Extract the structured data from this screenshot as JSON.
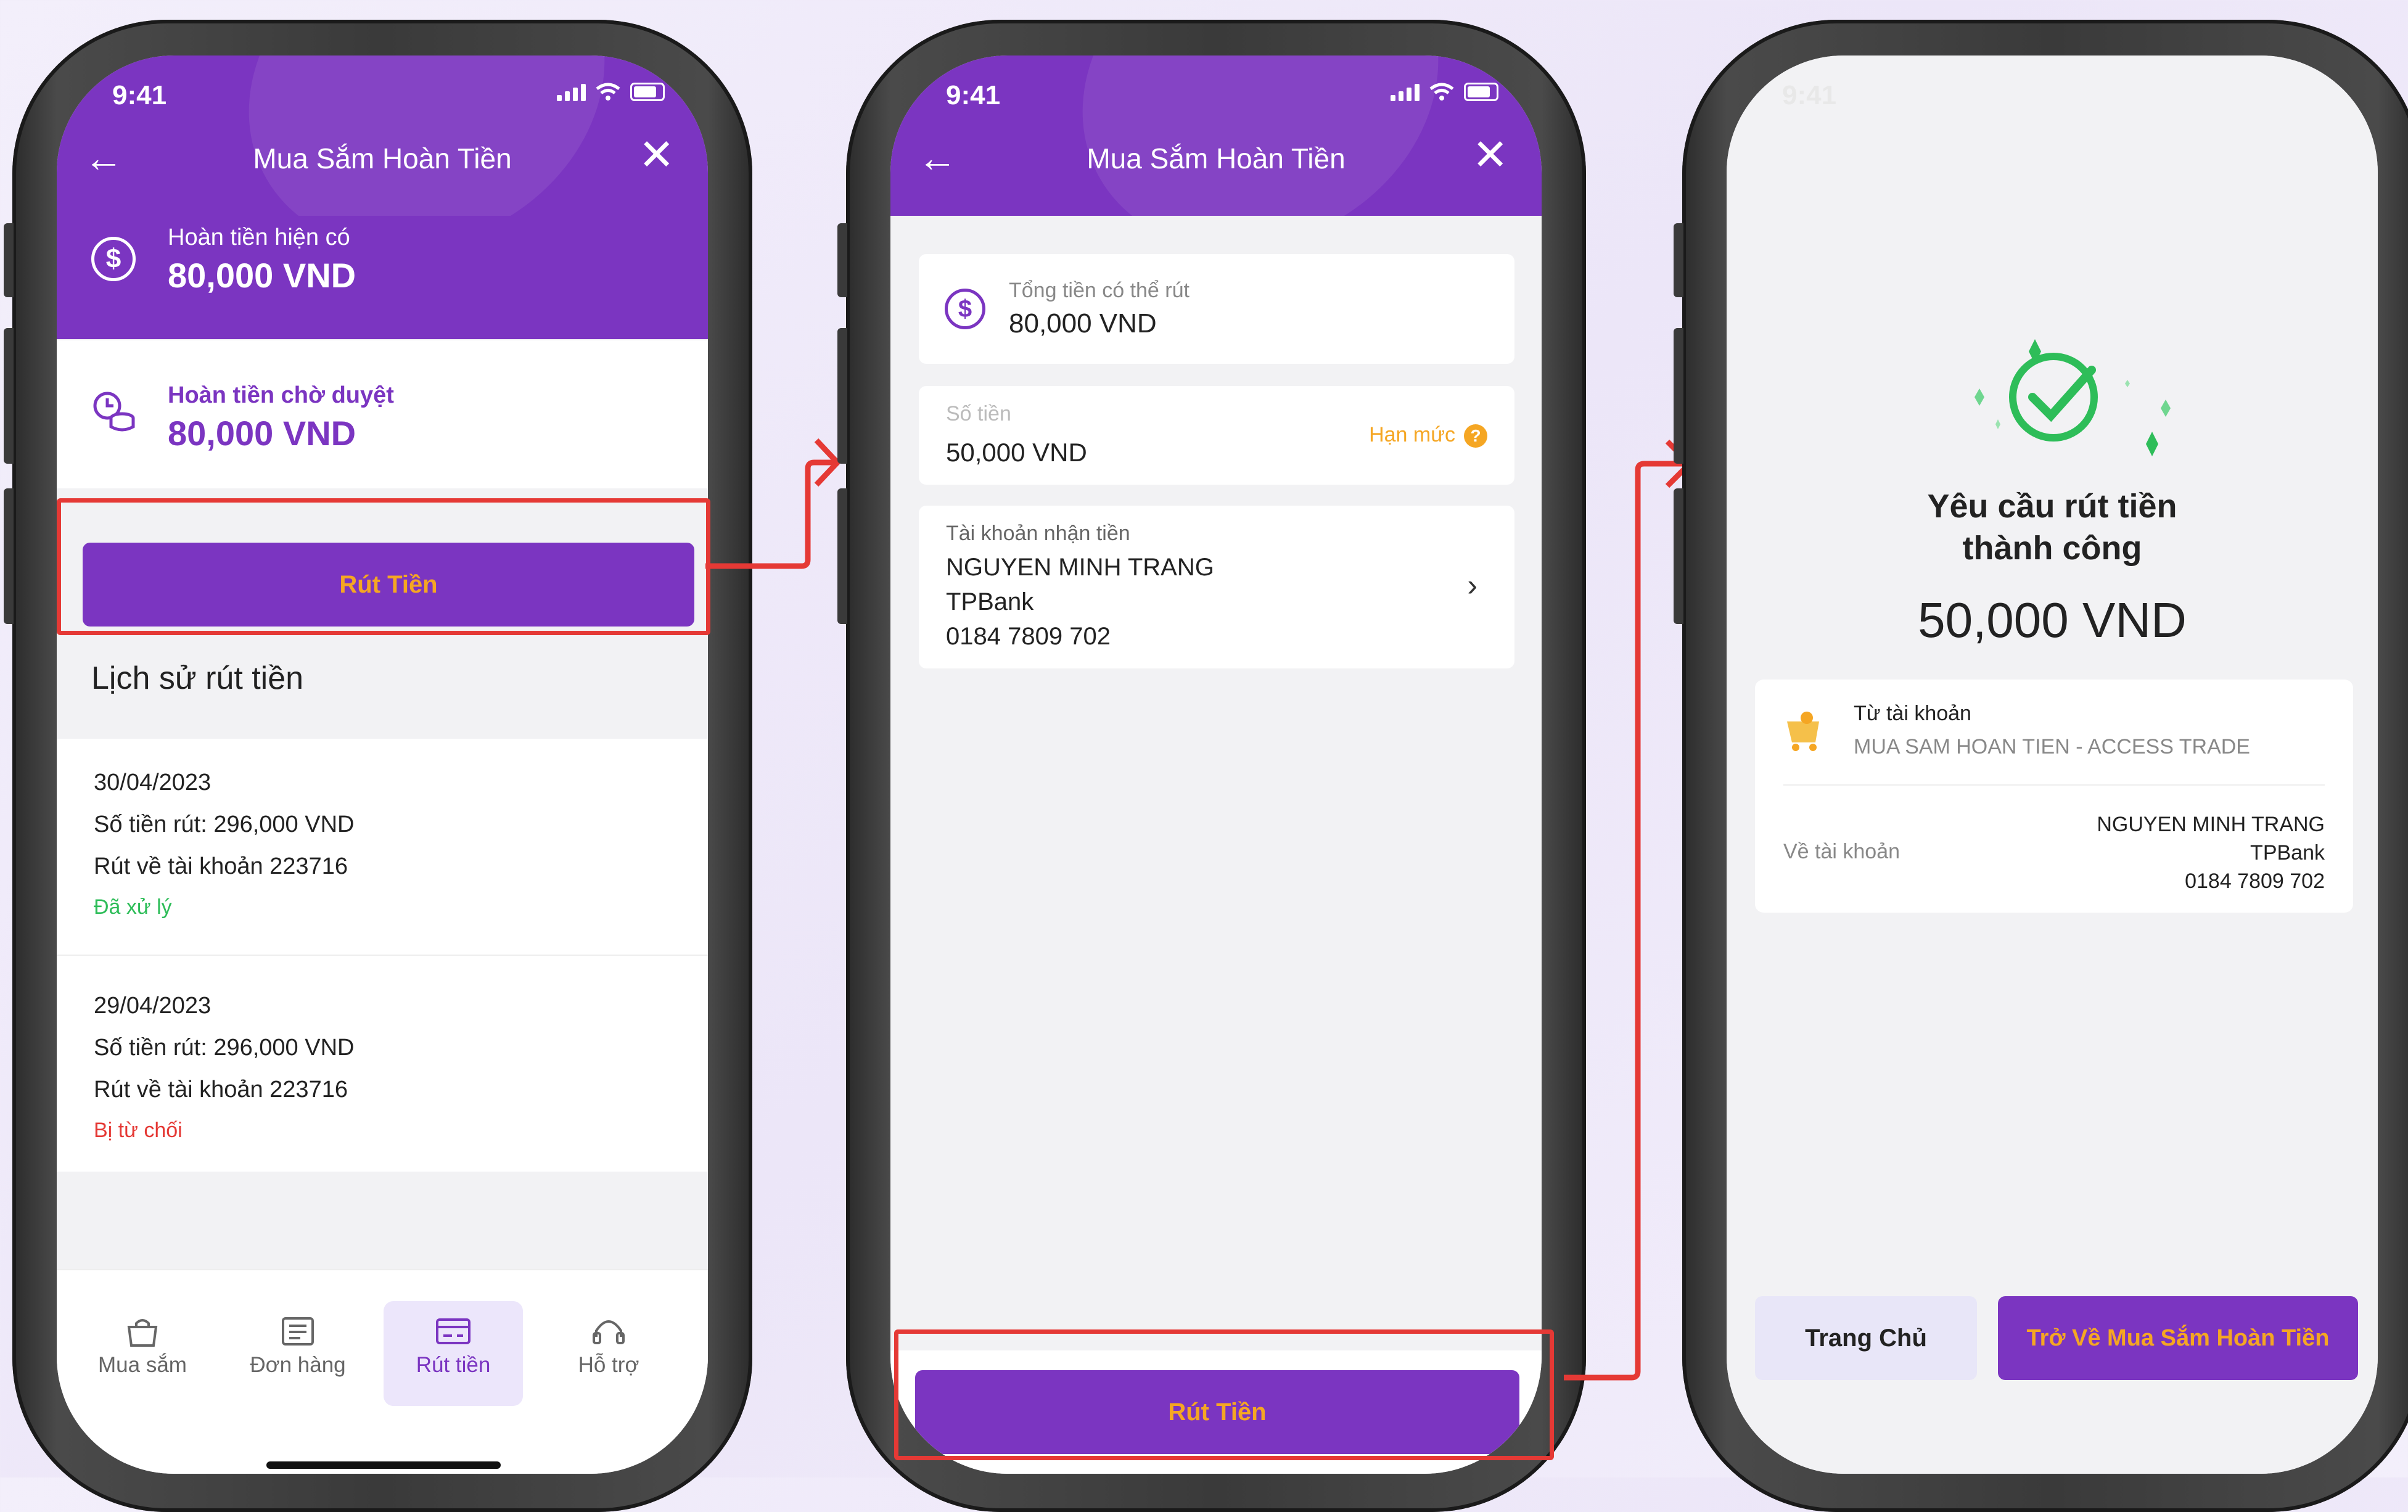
{
  "status": {
    "time": "9:41"
  },
  "screen1": {
    "header_title": "Mua Sắm Hoàn Tiền",
    "available_label": "Hoàn tiền hiện có",
    "available_value": "80,000 VND",
    "pending_label": "Hoàn tiền chờ duyệt",
    "pending_value": "80,000 VND",
    "withdraw_button": "Rút Tiền",
    "history_title": "Lịch sử rút tiền",
    "history": [
      {
        "date": "30/04/2023",
        "amount": "Số tiền rút: 296,000 VND",
        "account": "Rút về tài khoản 223716",
        "status": "Đã xử lý"
      },
      {
        "date": "29/04/2023",
        "amount": "Số tiền rút: 296,000 VND",
        "account": "Rút về tài khoản 223716",
        "status": "Bị từ chối"
      }
    ],
    "tabs": [
      {
        "label": "Mua sắm",
        "icon": "shopping-bag-icon"
      },
      {
        "label": "Đơn hàng",
        "icon": "order-list-icon"
      },
      {
        "label": "Rút tiền",
        "icon": "card-withdraw-icon"
      },
      {
        "label": "Hỗ trợ",
        "icon": "headset-icon"
      }
    ]
  },
  "screen2": {
    "header_title": "Mua Sắm Hoàn Tiền",
    "total_label": "Tổng tiền có thể rút",
    "total_value": "80,000 VND",
    "amount_label": "Số tiền",
    "amount_value": "50,000 VND",
    "limit_label": "Hạn mức",
    "receive_label": "Tài khoản nhận tiền",
    "receive_name": "NGUYEN MINH TRANG",
    "receive_bank": "TPBank",
    "receive_number": "0184 7809 702",
    "withdraw_button": "Rút Tiền"
  },
  "screen3": {
    "title_line1": "Yêu cầu rút tiền",
    "title_line2": "thành công",
    "amount": "50,000 VND",
    "from_label": "Từ tài khoản",
    "from_value": "MUA SAM HOAN TIEN - ACCESS TRADE",
    "to_label": "Về tài khoản",
    "to_name": "NGUYEN MINH TRANG",
    "to_bank": "TPBank",
    "to_number": "0184 7809 702",
    "home_button": "Trang Chủ",
    "back_button": "Trở Về Mua Sắm Hoàn Tiền"
  },
  "colors": {
    "brand": "#7b35c1",
    "accent": "#f5a623",
    "success": "#2ebd59",
    "error": "#e53935",
    "highlight": "#e53935"
  }
}
